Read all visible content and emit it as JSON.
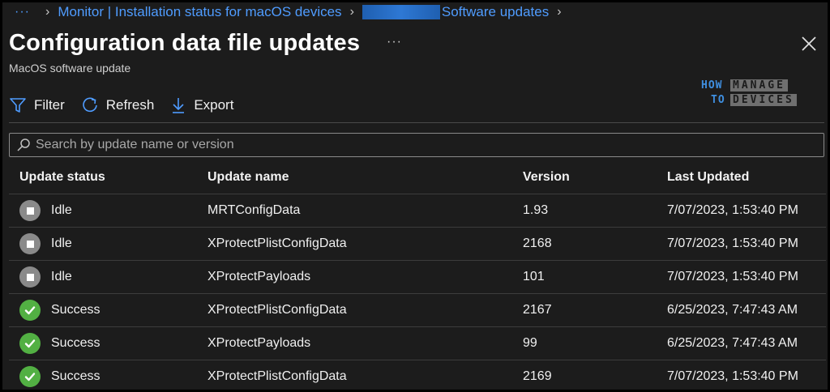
{
  "breadcrumb": {
    "more": "···",
    "items": [
      "Monitor | Installation status for macOS devices",
      "Software updates"
    ]
  },
  "header": {
    "title": "Configuration data file updates",
    "more": "···",
    "subtitle": "MacOS software update"
  },
  "toolbar": {
    "filter": "Filter",
    "refresh": "Refresh",
    "export": "Export"
  },
  "logo": {
    "how": "HOW",
    "to": "TO",
    "manage": "MANAGE",
    "devices": "DEVICES"
  },
  "search": {
    "placeholder": "Search by update name or version"
  },
  "table": {
    "columns": [
      "Update status",
      "Update name",
      "Version",
      "Last Updated"
    ],
    "rows": [
      {
        "status": "Idle",
        "icon": "idle-status-icon",
        "name": "MRTConfigData",
        "version": "1.93",
        "updated": "7/07/2023, 1:53:40 PM"
      },
      {
        "status": "Idle",
        "icon": "idle-status-icon",
        "name": "XProtectPlistConfigData",
        "version": "2168",
        "updated": "7/07/2023, 1:53:40 PM"
      },
      {
        "status": "Idle",
        "icon": "idle-status-icon",
        "name": "XProtectPayloads",
        "version": "101",
        "updated": "7/07/2023, 1:53:40 PM"
      },
      {
        "status": "Success",
        "icon": "success-check-icon",
        "name": "XProtectPlistConfigData",
        "version": "2167",
        "updated": "6/25/2023, 7:47:43 AM"
      },
      {
        "status": "Success",
        "icon": "success-check-icon",
        "name": "XProtectPayloads",
        "version": "99",
        "updated": "6/25/2023, 7:47:43 AM"
      },
      {
        "status": "Success",
        "icon": "success-check-icon",
        "name": "XProtectPlistConfigData",
        "version": "2169",
        "updated": "7/07/2023, 1:53:40 PM"
      }
    ]
  },
  "colors": {
    "accent": "#4f9cff",
    "success": "#52b043",
    "idle": "#8a8a8a",
    "background": "#1c1c1c"
  }
}
